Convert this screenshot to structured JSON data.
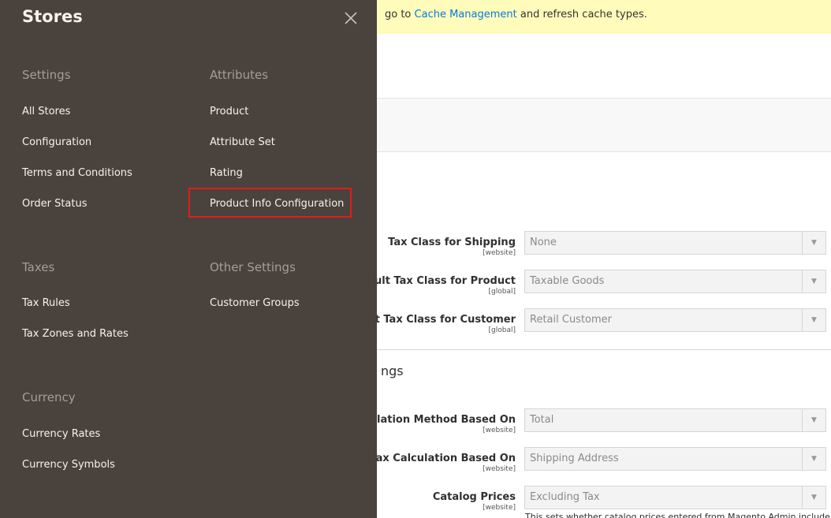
{
  "notice": {
    "prefix": "go to ",
    "link": "Cache Management",
    "suffix": " and refresh cache types."
  },
  "tax_rows": [
    {
      "label": "Tax Class for Shipping",
      "scope": "[website]",
      "value": "None"
    },
    {
      "label": "Default Tax Class for Product",
      "scope": "[global]",
      "value": "Taxable Goods"
    },
    {
      "label": "Default Tax Class for Customer",
      "scope": "[global]",
      "value": "Retail Customer"
    }
  ],
  "section_title": "ngs",
  "calc_rows": [
    {
      "label": "Calculation Method Based On",
      "scope": "[website]",
      "value": "Total"
    },
    {
      "label": "Tax Calculation Based On",
      "scope": "[website]",
      "value": "Shipping Address"
    },
    {
      "label": "Catalog Prices",
      "scope": "[website]",
      "value": "Excluding Tax"
    }
  ],
  "footnote": "This sets whether catalog prices entered from Magento Admin include tax.",
  "flyout": {
    "title": "Stores",
    "groups": {
      "settings": {
        "title": "Settings",
        "items": [
          "All Stores",
          "Configuration",
          "Terms and Conditions",
          "Order Status"
        ]
      },
      "attributes": {
        "title": "Attributes",
        "items": [
          "Product",
          "Attribute Set",
          "Rating",
          "Product Info Configuration"
        ]
      },
      "taxes": {
        "title": "Taxes",
        "items": [
          "Tax Rules",
          "Tax Zones and Rates"
        ]
      },
      "other": {
        "title": "Other Settings",
        "items": [
          "Customer Groups"
        ]
      },
      "currency": {
        "title": "Currency",
        "items": [
          "Currency Rates",
          "Currency Symbols"
        ]
      }
    }
  },
  "colors": {
    "flyout_bg": "#4a423d",
    "highlight": "#e31c1c",
    "link": "#007bdb",
    "notice_bg": "#fffbbb"
  },
  "icons": {
    "close": "close-icon",
    "select_arrow": "chevron-down-icon"
  }
}
